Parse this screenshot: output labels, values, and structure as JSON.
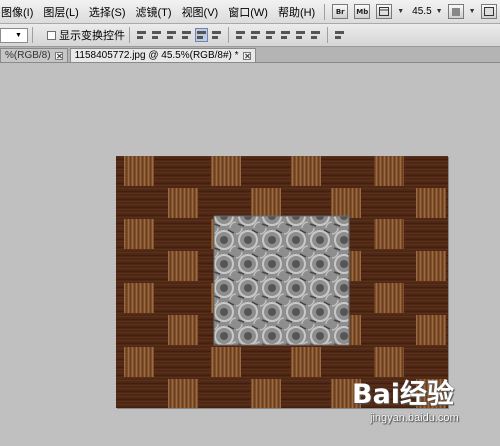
{
  "menu": {
    "items": [
      "图像(I)",
      "图层(L)",
      "选择(S)",
      "滤镜(T)",
      "视图(V)",
      "窗口(W)",
      "帮助(H)"
    ],
    "toolbar_buttons": [
      "Br",
      "Mb"
    ],
    "zoom_label": "45.5"
  },
  "options_bar": {
    "show_transform_label": "显示变换控件"
  },
  "tabs": [
    {
      "label": "%(RGB/8)",
      "active": false
    },
    {
      "label": "1158405772.jpg @ 45.5%(RGB/8#) *",
      "active": true
    }
  ],
  "watermark": {
    "main": "Bai经验",
    "sub": "jingyan.baidu.com"
  },
  "colors": {
    "wood_dark": "#4a2614",
    "wood_mid": "#5e3219",
    "strip_light": "#8b5a33",
    "strip_dark": "#6d4020",
    "center_bg": "#9a9a9a"
  }
}
